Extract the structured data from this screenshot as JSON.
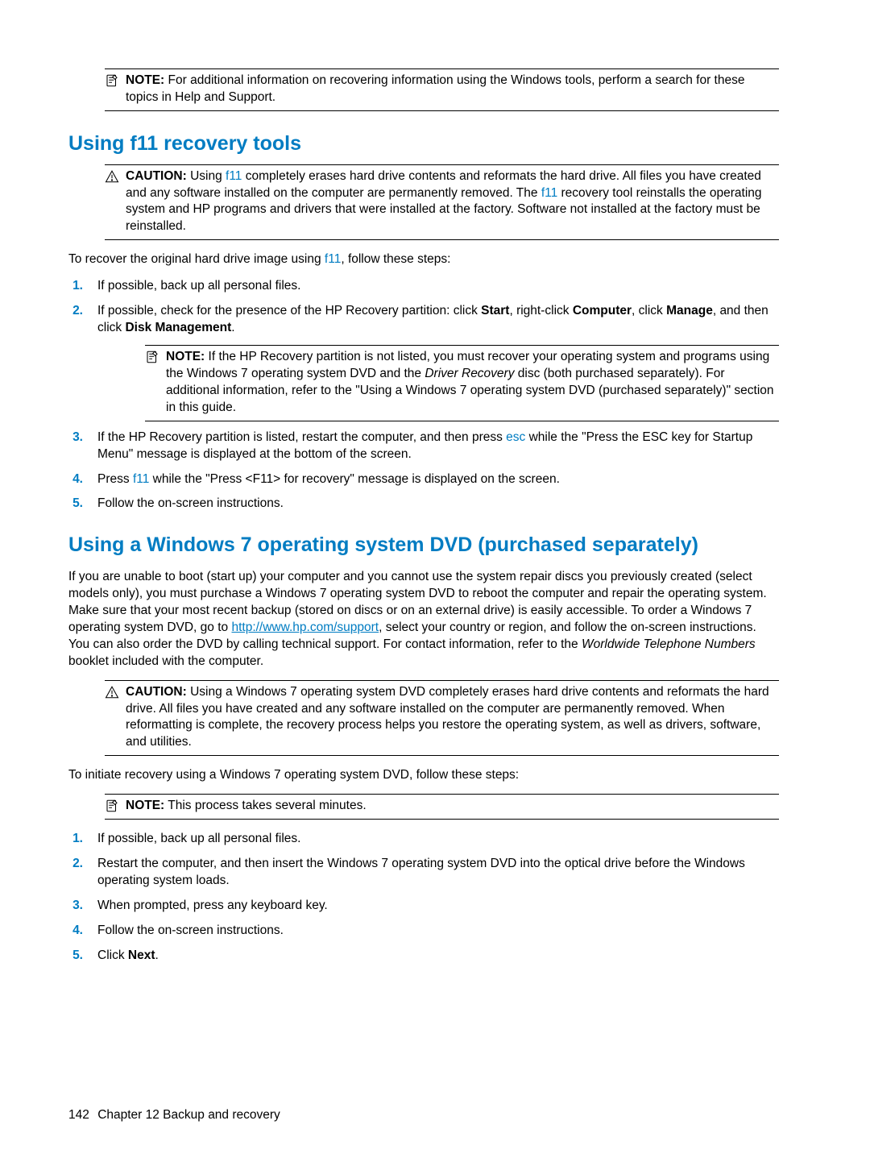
{
  "note_label": "NOTE:",
  "caution_label": "CAUTION:",
  "top_note": "For additional information on recovering information using the Windows tools, perform a search for these topics in Help and Support.",
  "section1": {
    "heading": "Using f11 recovery tools",
    "caution_pre": "Using ",
    "key1": "f11",
    "caution_mid": " completely erases hard drive contents and reformats the hard drive. All files you have created and any software installed on the computer are permanently removed. The ",
    "key2": "f11",
    "caution_post": " recovery tool reinstalls the operating system and HP programs and drivers that were installed at the factory. Software not installed at the factory must be reinstalled.",
    "intro_pre": "To recover the original hard drive image using ",
    "intro_key": "f11",
    "intro_post": ", follow these steps:",
    "steps": {
      "s1": "If possible, back up all personal files.",
      "s2_pre": "If possible, check for the presence of the HP Recovery partition: click ",
      "s2_b1": "Start",
      "s2_mid1": ", right-click ",
      "s2_b2": "Computer",
      "s2_mid2": ", click ",
      "s2_b3": "Manage",
      "s2_mid3": ", and then click ",
      "s2_b4": "Disk Management",
      "s2_post": ".",
      "note_pre": "If the HP Recovery partition is not listed, you must recover your operating system and programs using the Windows 7 operating system DVD and the ",
      "note_italic": "Driver Recovery",
      "note_post": " disc (both purchased separately). For additional information, refer to the \"Using a Windows 7 operating system DVD (purchased separately)\" section in this guide.",
      "s3_pre": "If the HP Recovery partition is listed, restart the computer, and then press ",
      "s3_key": "esc",
      "s3_post": " while the \"Press the ESC key for Startup Menu\" message is displayed at the bottom of the screen.",
      "s4_pre": "Press ",
      "s4_key": "f11",
      "s4_post": " while the \"Press <F11> for recovery\" message is displayed on the screen.",
      "s5": "Follow the on-screen instructions."
    }
  },
  "section2": {
    "heading": "Using a Windows 7 operating system DVD (purchased separately)",
    "p1_pre": "If you are unable to boot (start up) your computer and you cannot use the system repair discs you previously created (select models only), you must purchase a Windows 7 operating system DVD to reboot the computer and repair the operating system. Make sure that your most recent backup (stored on discs or on an external drive) is easily accessible. To order a Windows 7 operating system DVD, go to ",
    "p1_link": "http://www.hp.com/support",
    "p1_mid": ", select your country or region, and follow the on-screen instructions. You can also order the DVD by calling technical support. For contact information, refer to the ",
    "p1_italic": "Worldwide Telephone Numbers",
    "p1_post": " booklet included with the computer.",
    "caution": "Using a Windows 7 operating system DVD completely erases hard drive contents and reformats the hard drive. All files you have created and any software installed on the computer are permanently removed. When reformatting is complete, the recovery process helps you restore the operating system, as well as drivers, software, and utilities.",
    "intro": "To initiate recovery using a Windows 7 operating system DVD, follow these steps:",
    "note": "This process takes several minutes.",
    "steps": {
      "s1": "If possible, back up all personal files.",
      "s2": "Restart the computer, and then insert the Windows 7 operating system DVD into the optical drive before the Windows operating system loads.",
      "s3": "When prompted, press any keyboard key.",
      "s4": "Follow the on-screen instructions.",
      "s5_pre": "Click ",
      "s5_b": "Next",
      "s5_post": "."
    }
  },
  "footer": {
    "page": "142",
    "chapter": "Chapter 12   Backup and recovery"
  },
  "nums": {
    "n1": "1.",
    "n2": "2.",
    "n3": "3.",
    "n4": "4.",
    "n5": "5."
  }
}
